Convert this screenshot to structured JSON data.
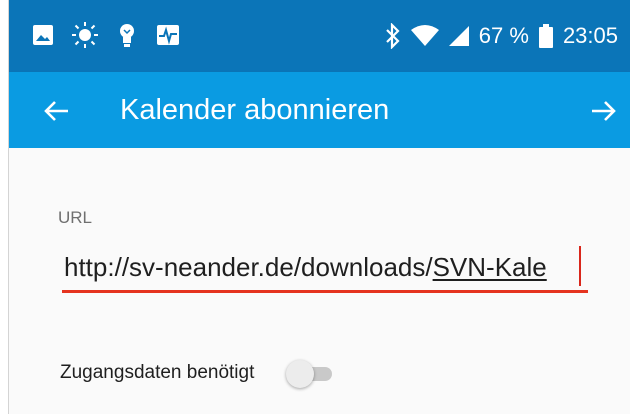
{
  "status_bar": {
    "left_icons": [
      "image-icon",
      "brightness-icon",
      "lightbulb-icon",
      "activity-icon"
    ],
    "right_icons": [
      "bluetooth-icon",
      "wifi-icon",
      "signal-icon",
      "battery-icon"
    ],
    "battery_percent_text": "67 %",
    "time": "23:05"
  },
  "app_bar": {
    "title": "Kalender abonnieren",
    "back_icon": "arrow-left-icon",
    "forward_icon": "arrow-right-icon"
  },
  "form": {
    "url_label": "URL",
    "url_value_prefix": "http://sv-neander.de/downloads/",
    "url_value_underlined": "SVN-Kale",
    "credentials_toggle": {
      "label": "Zugangsdaten benötigt",
      "checked": false
    }
  },
  "colors": {
    "status_bar_bg": "#0b75b8",
    "app_bar_bg": "#0a9be2",
    "accent_error": "#e5331f",
    "page_bg": "#fafafa"
  }
}
